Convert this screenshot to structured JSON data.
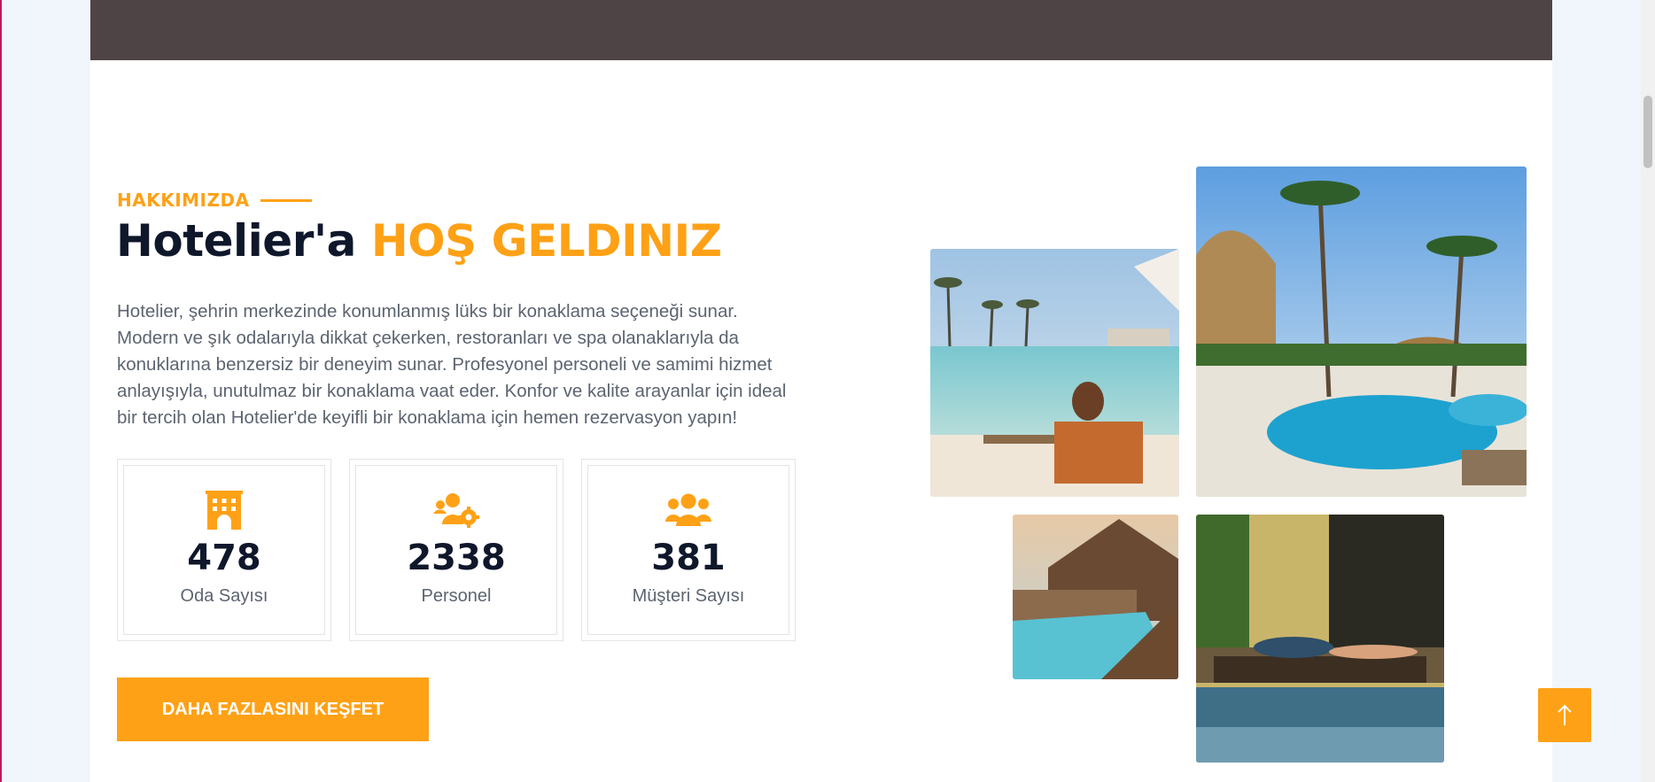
{
  "about": {
    "eyebrow": "HAKKIMIZDA",
    "title_prefix": "Hotelier'a",
    "title_accent": "HOŞ GELDINIZ",
    "description": "Hotelier, şehrin merkezinde konumlanmış lüks bir konaklama seçeneği sunar. Modern ve şık odalarıyla dikkat çekerken, restoranları ve spa olanaklarıyla da konuklarına benzersiz bir deneyim sunar. Profesyonel personeli ve samimi hizmet anlayışıyla, unutulmaz bir konaklama vaat eder. Konfor ve kalite arayanlar için ideal bir tercih olan Hotelier'de keyifli bir konaklama için hemen rezervasyon yapın!",
    "stats": [
      {
        "icon": "hotel-icon",
        "value": "478",
        "label": "Oda Sayısı"
      },
      {
        "icon": "users-gear-icon",
        "value": "2338",
        "label": "Personel"
      },
      {
        "icon": "users-icon",
        "value": "381",
        "label": "Müşteri Sayısı"
      }
    ],
    "cta_label": "DAHA FAZLASINI KEŞFET"
  },
  "gallery": [
    {
      "name": "pool-lounge-photo"
    },
    {
      "name": "tropical-pool-photo"
    },
    {
      "name": "poolside-restaurant-photo"
    },
    {
      "name": "sunbathing-photo"
    }
  ],
  "back_to_top_icon": "arrow-up-icon",
  "colors": {
    "accent": "#fea116",
    "dark": "#0f172b",
    "text": "#5c6470",
    "hero_strip": "#4f4445"
  }
}
